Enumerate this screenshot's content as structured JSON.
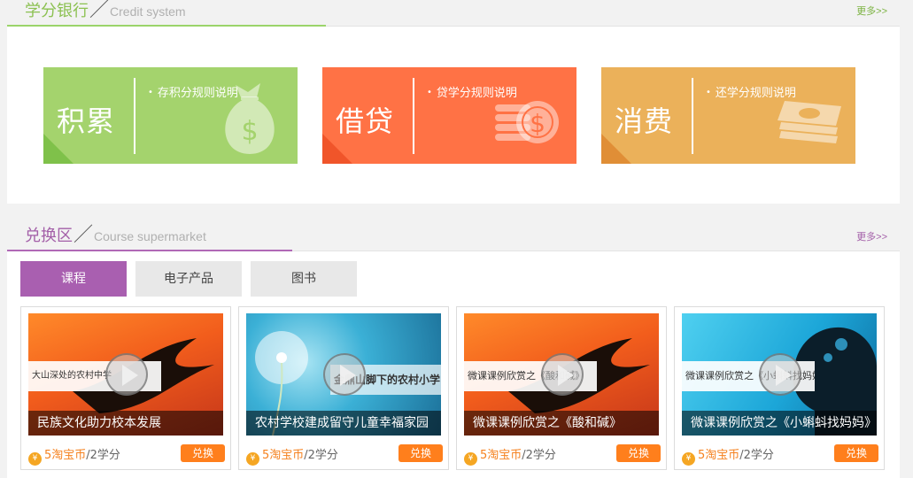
{
  "credit": {
    "title_cn": "学分银行",
    "title_en": "Credit system",
    "more": "更多>>",
    "cards": [
      {
        "label": "积累",
        "rule": "存积分规则说明",
        "icon": "money-bag-icon"
      },
      {
        "label": "借贷",
        "rule": "贷学分规则说明",
        "icon": "coin-stack-icon"
      },
      {
        "label": "消费",
        "rule": "还学分规则说明",
        "icon": "cash-stack-icon"
      }
    ],
    "colors": {
      "accumulate": "#a4d36d",
      "borrow": "#ff7245",
      "consume": "#ebb15a"
    }
  },
  "exchange": {
    "title_cn": "兑换区",
    "title_en": "Course supermarket",
    "more": "更多>>",
    "tabs": [
      {
        "label": "课程",
        "active": true
      },
      {
        "label": "电子产品",
        "active": false
      },
      {
        "label": "图书",
        "active": false
      }
    ],
    "products": [
      {
        "title": "民族文化助力校本发展",
        "banner": "大山深处的农村中学",
        "price": "5淘宝币",
        "credit": "/2学分",
        "button": "兑换"
      },
      {
        "title": "农村学校建成留守儿童幸福家园",
        "banner": "金鼎山脚下的农村小学",
        "price": "5淘宝币",
        "credit": "/2学分",
        "button": "兑换"
      },
      {
        "title": "微课课例欣赏之《酸和碱》",
        "banner": "微课课例欣赏之《酸和碱》",
        "price": "5淘宝币",
        "credit": "/2学分",
        "button": "兑换"
      },
      {
        "title": "微课课例欣赏之《小蝌蚪找妈妈》",
        "banner": "微课课例欣赏之《小蝌蚪找妈妈》",
        "price": "5淘宝币",
        "credit": "/2学分",
        "button": "兑换"
      }
    ],
    "colors": {
      "accent": "#a95fb0",
      "button": "#ff7f1c",
      "price": "#f58220"
    }
  }
}
